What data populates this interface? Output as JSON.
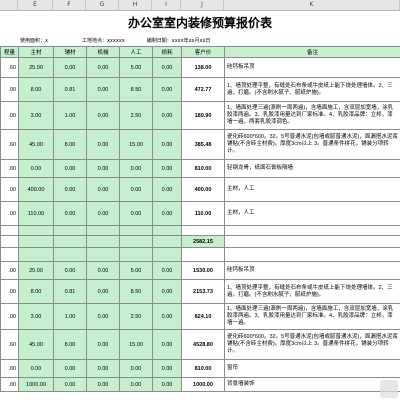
{
  "colheaders": [
    "",
    "E",
    "F",
    "G",
    "H",
    "I",
    "J",
    "K"
  ],
  "title": "办公室室内装修预算报价表",
  "info": {
    "client": "使用面积：x",
    "location": "工地地点：xxxxxx",
    "date": "编制日期：xxxx年xx月xx日"
  },
  "headers": [
    "程量",
    "主材",
    "辅材",
    "机械",
    "人工",
    "损耗",
    "客户价",
    "备注"
  ],
  "rows": [
    {
      "c": [
        ".60",
        "25.00",
        "0.00",
        "0.00",
        "5.00",
        "0.00",
        "138.00",
        "硅钙板吊顶"
      ],
      "h": 20
    },
    {
      "c": [
        ".00",
        "8.00",
        "0.81",
        "0.00",
        "8.50",
        "0.00",
        "472.77",
        "1、墙顶处理平整，有缝处石布条或牛皮纸上能下烧处理墙体。2、三遍，打磨。(不含刷水腻子、腻纸炉施)。"
      ],
      "h": 24
    },
    {
      "c": [
        ".00",
        "3.00",
        "1.00",
        "0.00",
        "2.50",
        "0.00",
        "180.90",
        "1、墙面处理三遍(滚刷一周两遍)，含墙面施工，含双层加宽墙，涂乳胶漆两遍。3、乳胶漆用量达到厂家标准。4、乳胶漆品牌：立邦，漆墙一遍，两套乳胶漆调色。"
      ],
      "h": 28
    },
    {
      "c": [
        ".60",
        "45.00",
        "8.00",
        "0.00",
        "15.00",
        "0.00",
        "385.48",
        "瓷化砖600*600。32。5号普通水泥(包墙或腻普通水泥)，面漏搭水泥浆铺贴(不含砖主材费)。厚度3cm以上 3。普通条件拼花，铺装分项转计。"
      ],
      "h": 30
    },
    {
      "c": [
        ".00",
        "0.00",
        "0.00",
        "0.00",
        "0.00",
        "0.00",
        "810.00",
        "轻钢龙骨，纸面石膏板隔墙"
      ],
      "h": 18
    },
    {
      "c": [
        ".00",
        "400.00",
        "0.00",
        "0.00",
        "0.00",
        "0.00",
        "400.00",
        "主材，人工"
      ],
      "h": 24
    },
    {
      "c": [
        ".00",
        "110.00",
        "0.00",
        "0.00",
        "0.00",
        "0.00",
        "110.00",
        "主材，人工"
      ],
      "h": 24
    },
    {
      "c": [
        "",
        "",
        "",
        "",
        "",
        "",
        "",
        ""
      ],
      "h": 10
    },
    {
      "c": [
        "",
        "",
        "",
        "",
        "",
        "",
        "2582.15",
        ""
      ],
      "h": 12,
      "sum": true
    },
    {
      "c": [
        "",
        "",
        "",
        "",
        "",
        "",
        "",
        ""
      ],
      "h": 14
    },
    {
      "c": [
        ".00",
        "25.00",
        "0.00",
        "0.00",
        "5.00",
        "0.00",
        "1530.00",
        "硅钙板吊顶"
      ],
      "h": 18
    },
    {
      "c": [
        ".00",
        "8.00",
        "0.81",
        "0.00",
        "8.50",
        "0.00",
        "2153.73",
        "1、墙顶处理平整，有缝处石布条或牛皮纸上能下烧处理墙体。2、三遍，打磨。(不含刷水腻子、腻纸炉施)。"
      ],
      "h": 24
    },
    {
      "c": [
        ".00",
        "3.00",
        "1.00",
        "0.00",
        "2.50",
        "0.00",
        "824.10",
        "1、墙面处理三遍(滚刷一周两遍)，含墙面施工，含双层加宽墙，涂乳胶漆两遍。3、乳胶漆用量达到厂家标准。4、乳胶漆品牌：立邦，漆墙一遍。"
      ],
      "h": 26
    },
    {
      "c": [
        ".60",
        "45.00",
        "8.00",
        "0.00",
        "15.00",
        "0.00",
        "4528.80",
        "瓷化砖600*600。32。5号普通水泥(包墙或腻普通水泥)，面漏搭水泥浆铺贴(不含砖主材费)。厚度3cm以上 3。普通条件拼花，铺装分项转计。"
      ],
      "h": 30
    },
    {
      "c": [
        ".00",
        "0.00",
        "0.00",
        "0.00",
        "0.00",
        "0.00",
        "810.00",
        "窗帘"
      ],
      "h": 18
    },
    {
      "c": [
        ".00",
        "1000.00",
        "0.00",
        "0.00",
        "0.00",
        "0.00",
        "1000.00",
        "背景墙装饰"
      ],
      "h": 14
    }
  ]
}
